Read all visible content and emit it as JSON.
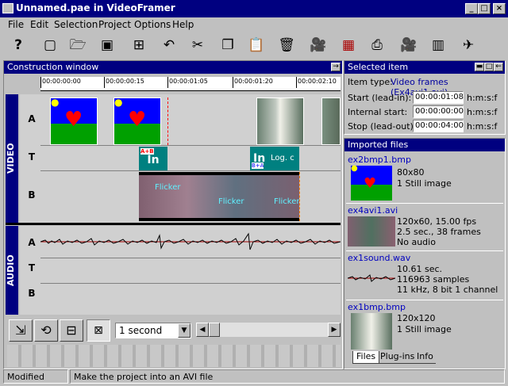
{
  "window": {
    "title": "Unnamed.pae in VideoFramer"
  },
  "menu": [
    "File",
    "Edit",
    "Selection",
    "Project",
    "Options",
    "Help"
  ],
  "construction": {
    "title": "Construction window",
    "timecodes": [
      "00:00:00:00",
      "00:00:00:15",
      "00:00:01:05",
      "00:00:01:20",
      "00:00:02:10"
    ],
    "video_label": "VIDEO",
    "audio_label": "AUDIO",
    "tracks": {
      "a": "A",
      "t": "T",
      "b": "B"
    },
    "transition_text": "In",
    "transition_badge": "A+B",
    "transition_badge2": "B+A",
    "log_text": "Log. c",
    "flicker_text": "Flicker"
  },
  "bottom": {
    "zoom_value": "1 second"
  },
  "selected": {
    "title": "Selected item",
    "item_type_label": "Item type:",
    "item_type_value": "Video frames (Ex4avi1.avi)",
    "start_label": "Start (lead-in):",
    "start_value": "00:00:01:08",
    "internal_label": "Internal start:",
    "internal_value": "00:00:00:00",
    "stop_label": "Stop (lead-out):",
    "stop_value": "00:00:04:00",
    "unit": "h:m:s:f"
  },
  "imported": {
    "title": "Imported files",
    "files": [
      {
        "name": "ex2bmp1.bmp",
        "l1": "80x80",
        "l2": "1 Still image",
        "l3": "",
        "l4": ""
      },
      {
        "name": "ex4avi1.avi",
        "l1": "120x60, 15.00 fps",
        "l2": "2.5 sec., 38 frames",
        "l3": "No audio",
        "l4": ""
      },
      {
        "name": "ex1sound.wav",
        "l1": "10.61 sec.",
        "l2": "116963 samples",
        "l3": "11 kHz, 8 bit 1 channel",
        "l4": ""
      },
      {
        "name": "ex1bmp.bmp",
        "l1": "120x120",
        "l2": "1 Still image",
        "l3": "",
        "l4": ""
      }
    ],
    "tabs": [
      "Files",
      "Plug-ins",
      "Info"
    ]
  },
  "status": {
    "left": "Modified",
    "right": "Make the project into an AVI file"
  }
}
